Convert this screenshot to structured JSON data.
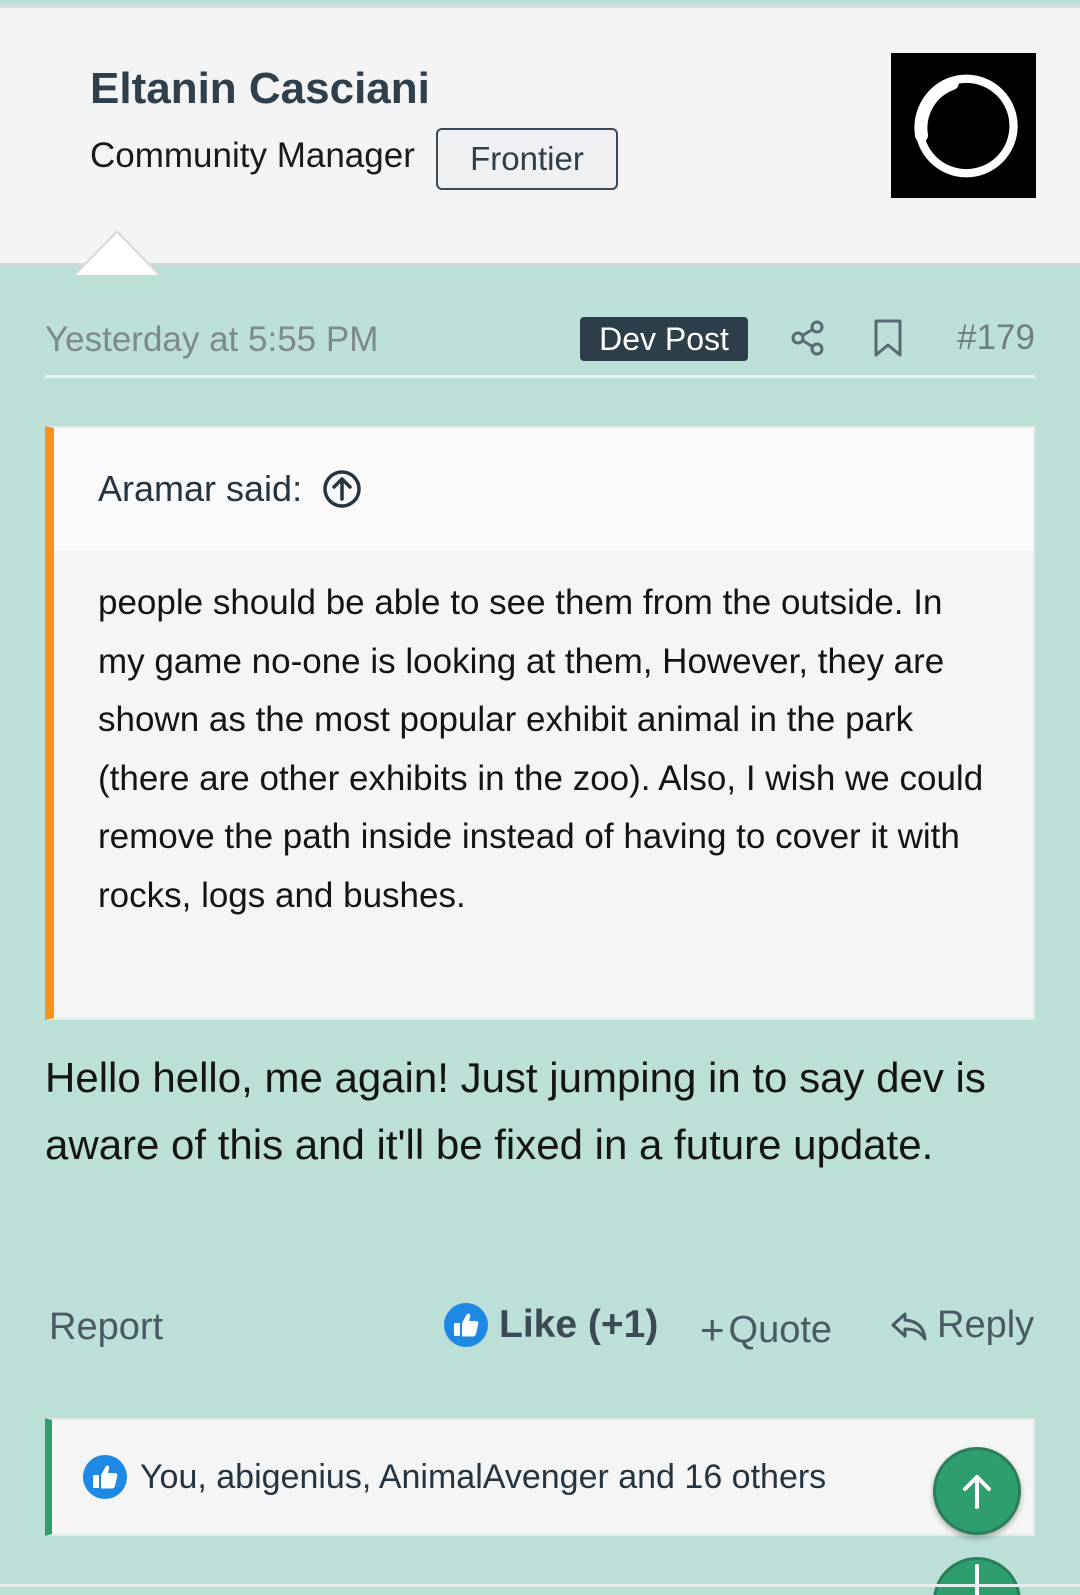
{
  "user": {
    "name": "Eltanin Casciani",
    "title": "Community Manager",
    "badge": "Frontier",
    "avatar_icon": "frontier-logo"
  },
  "post": {
    "time": "Yesterday at 5:55 PM",
    "tag": "Dev Post",
    "number": "#179",
    "quote": {
      "author": "Aramar said:",
      "text": "people should be able to see them from the outside. In my game no-one is looking at them, However, they are shown as the most popular exhibit animal in the park (there are other exhibits in the zoo). Also, I wish we could remove the path inside instead of having to cover it with rocks, logs and bushes."
    },
    "body": "Hello hello, me again! Just jumping in to say dev is aware of this and it'll be fixed in a future update."
  },
  "actions": {
    "report": "Report",
    "like": "Like (+1)",
    "quote": "Quote",
    "reply": "Reply"
  },
  "reactions": {
    "text": "You, abigenius, AnimalAvenger and 16 others"
  },
  "colors": {
    "post_bg": "#bcdfd8",
    "quote_accent": "#f7941d",
    "reaction_accent": "#2f9e6f",
    "like_blue": "#1e88e5"
  }
}
